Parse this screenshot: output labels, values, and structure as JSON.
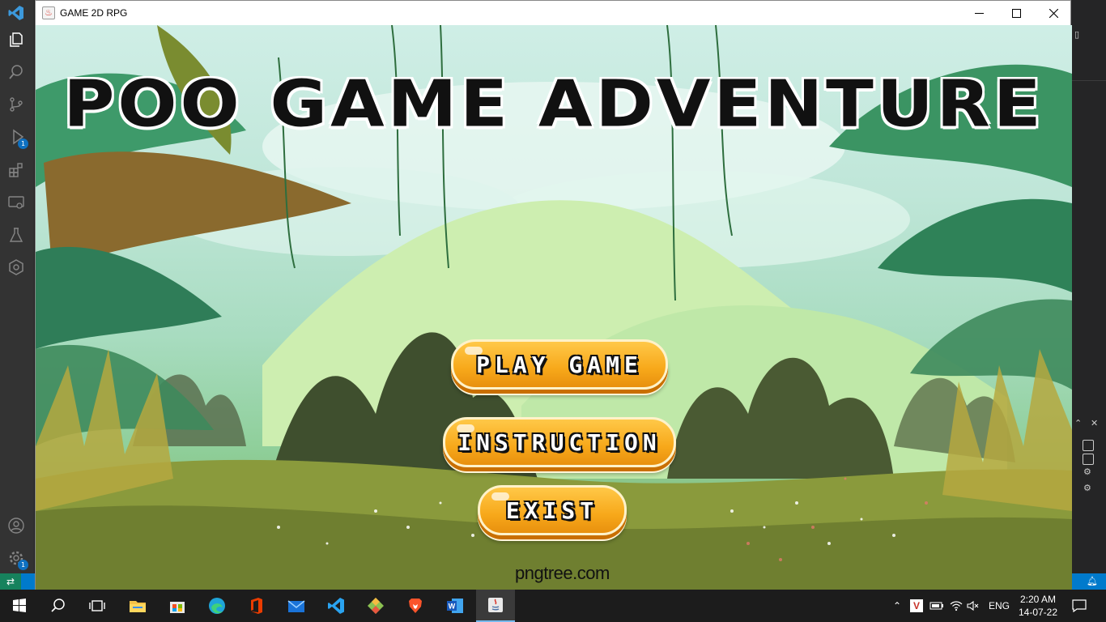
{
  "window": {
    "title": "GAME 2D RPG",
    "icon": "java-icon",
    "controls": [
      "minimize-icon",
      "maximize-icon",
      "close-icon"
    ]
  },
  "game": {
    "title": "POO GAME ADVENTURE",
    "buttons": {
      "play": "PLAY GAME",
      "instruction": "INSTRUCTION",
      "exit": "EXIST"
    },
    "watermark": "pngtree.com"
  },
  "vscode": {
    "activity_icons": [
      "explorer-icon",
      "search-icon",
      "source-control-icon",
      "run-debug-icon",
      "extensions-icon",
      "remote-explorer-icon",
      "testing-icon",
      "gitlens-icon",
      "account-icon",
      "settings-icon"
    ],
    "badges": {
      "run_debug": "1",
      "settings": "1"
    }
  },
  "taskbar": {
    "apps": [
      "start-icon",
      "search-icon",
      "task-view-icon",
      "file-explorer-icon",
      "store-icon",
      "edge-icon",
      "office-icon",
      "mail-icon",
      "vscode-icon",
      "git-icon",
      "brave-icon",
      "word-icon",
      "java-icon"
    ],
    "language": "ENG",
    "time": "2:20 AM",
    "date": "14-07-22"
  },
  "colors": {
    "button_fill": "#f7a81a",
    "taskbar": "#1c1c1c",
    "status_bar": "#007acc"
  }
}
